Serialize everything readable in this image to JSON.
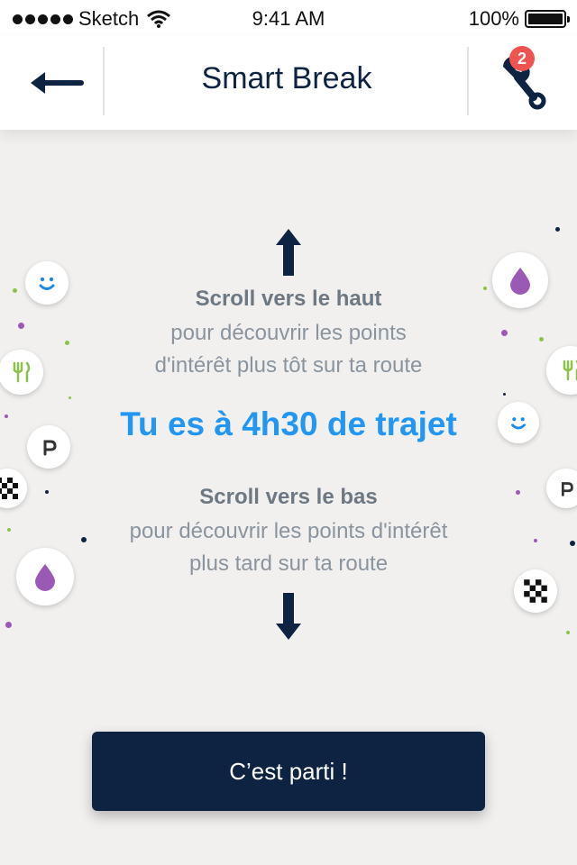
{
  "status_bar": {
    "carrier": "Sketch",
    "time": "9:41 AM",
    "battery": "100%"
  },
  "header": {
    "title": "Smart Break",
    "badge_count": "2"
  },
  "main": {
    "up_title": "Scroll vers le haut",
    "up_line1": "pour découvrir les points",
    "up_line2": "d'intérêt plus tôt sur ta route",
    "headline": "Tu es à 4h30 de trajet",
    "down_title": "Scroll vers le bas",
    "down_line1": "pour découvrir les points d'intérêt",
    "down_line2": "plus tard sur ta route"
  },
  "cta": {
    "label": "C’est parti !"
  },
  "colors": {
    "navy": "#0d2341",
    "accent": "#2196f3",
    "badge": "#ef5350",
    "purple": "#9b59b6",
    "green": "#8bc34a"
  },
  "decor_icons": [
    "smile-icon",
    "drop-icon",
    "fork-knife-icon",
    "parking-icon",
    "checkered-flag-icon"
  ]
}
